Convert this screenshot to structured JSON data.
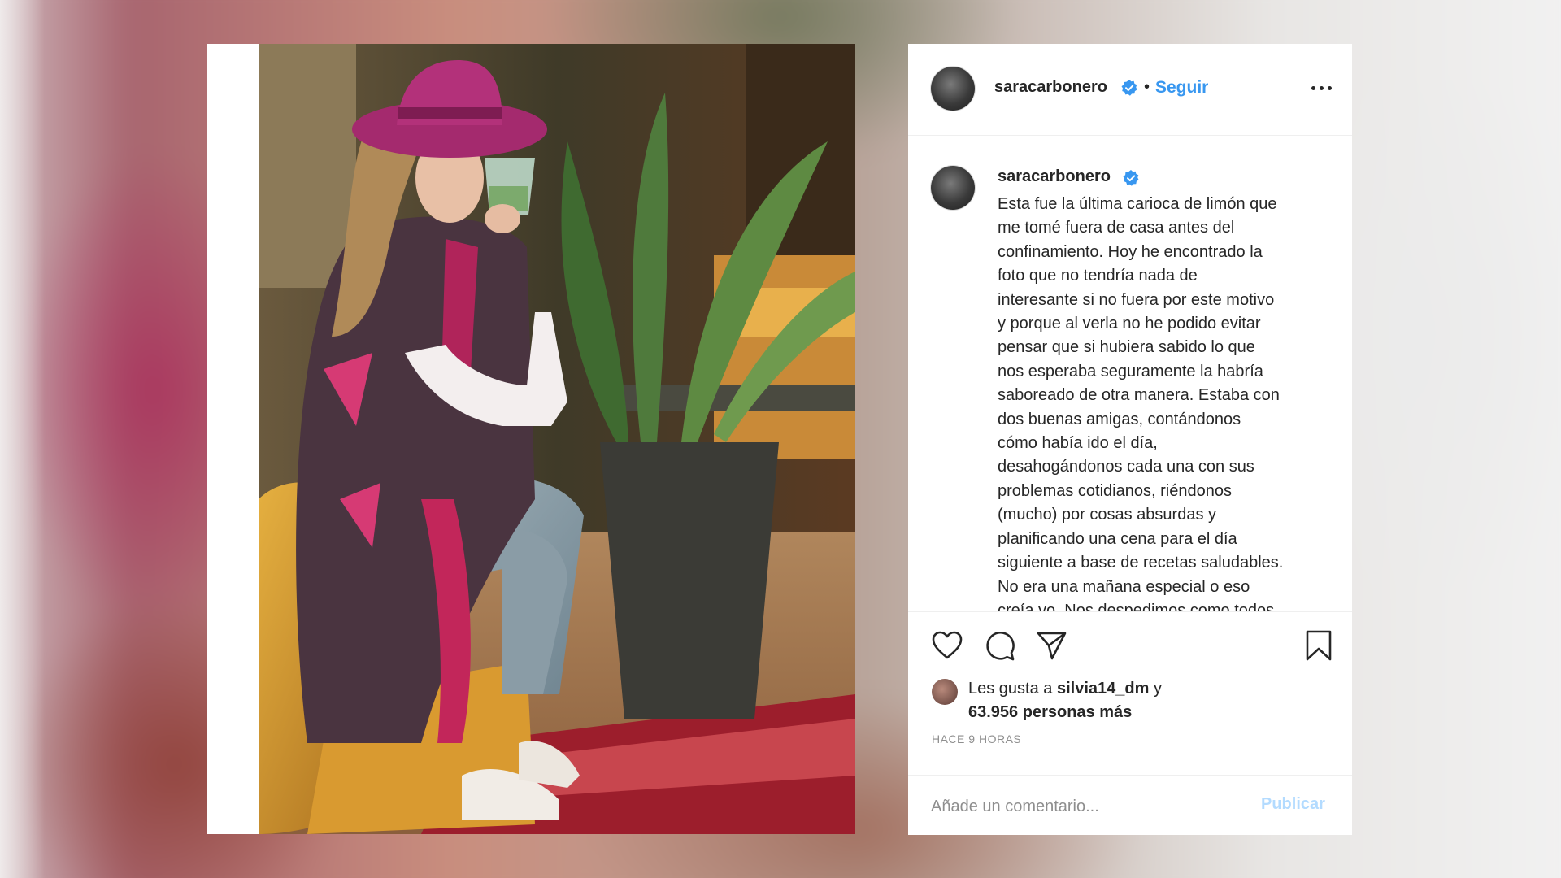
{
  "post": {
    "username": "saracarbonero",
    "separator": "•",
    "follow_label": "Seguir",
    "more_icon": "more-options-icon",
    "verified_icon": "verified-badge-icon",
    "verified_color": "#3897f0",
    "caption_lines": [
      "Esta fue la última carioca de limón que",
      "me tomé fuera de casa antes del",
      "confinamiento. Hoy he encontrado la",
      "foto que no tendría nada de",
      "interesante si no fuera por este motivo",
      "y porque al verla no he podido evitar",
      "pensar que si hubiera sabido lo que",
      "nos esperaba seguramente la habría",
      "saboreado de otra manera. Estaba con",
      "dos buenas amigas, contándonos",
      "cómo había ido el día,",
      "desahogándonos cada una con sus",
      "problemas cotidianos, riéndonos",
      "(mucho) por cosas absurdas y",
      "planificando una cena para el día",
      "siguiente a base de recetas saludables.",
      "No era una mañana especial o eso",
      "creía yo. Nos despedimos como todos"
    ],
    "likes": {
      "prefix": "Les gusta a ",
      "user": "silvia14_dm",
      "connector": " y",
      "count_text": "63.956 personas más"
    },
    "timestamp": "HACE 9 HORAS",
    "comment": {
      "placeholder": "Añade un comentario...",
      "value": "",
      "publish_label": "Publicar"
    },
    "actions": [
      "heart-icon",
      "comment-icon",
      "share-icon",
      "bookmark-icon"
    ]
  }
}
